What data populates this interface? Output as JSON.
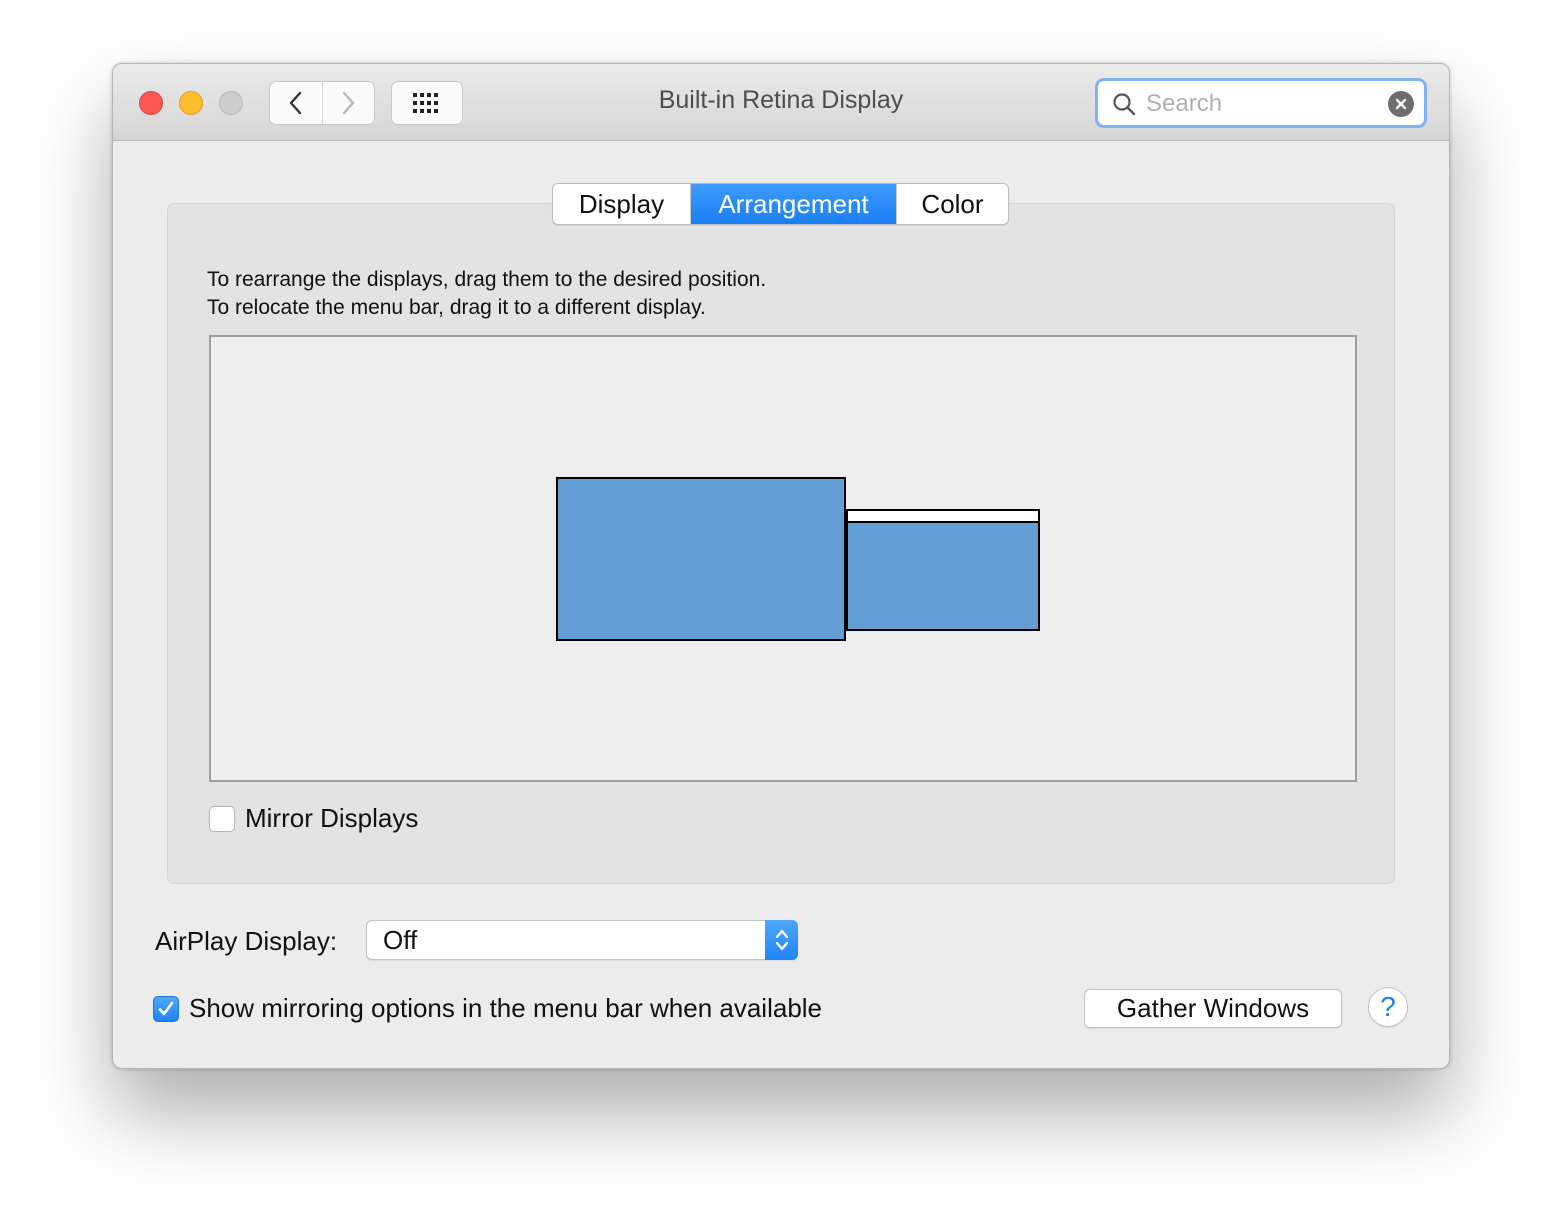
{
  "window": {
    "title": "Built-in Retina Display"
  },
  "toolbar": {
    "back_icon": "chevron-left-icon",
    "forward_icon": "chevron-right-icon",
    "show_all_icon": "grid-icon"
  },
  "search": {
    "placeholder": "Search",
    "value": ""
  },
  "tabs": [
    {
      "label": "Display",
      "active": false
    },
    {
      "label": "Arrangement",
      "active": true
    },
    {
      "label": "Color",
      "active": false
    }
  ],
  "arrangement": {
    "instruction_line1": "To rearrange the displays, drag them to the desired position.",
    "instruction_line2": "To relocate the menu bar, drag it to a different display.",
    "display_color": "#659ed4",
    "mirror_label": "Mirror Displays",
    "mirror_checked": false
  },
  "airplay": {
    "label": "AirPlay Display:",
    "value": "Off"
  },
  "show_mirroring": {
    "label": "Show mirroring options in the menu bar when available",
    "checked": true
  },
  "buttons": {
    "gather_windows": "Gather Windows",
    "help": "?"
  },
  "colors": {
    "accent": "#1f84f6",
    "close": "#fc5753",
    "minimize": "#fdbc2e",
    "zoom": "#cdcdcd"
  }
}
